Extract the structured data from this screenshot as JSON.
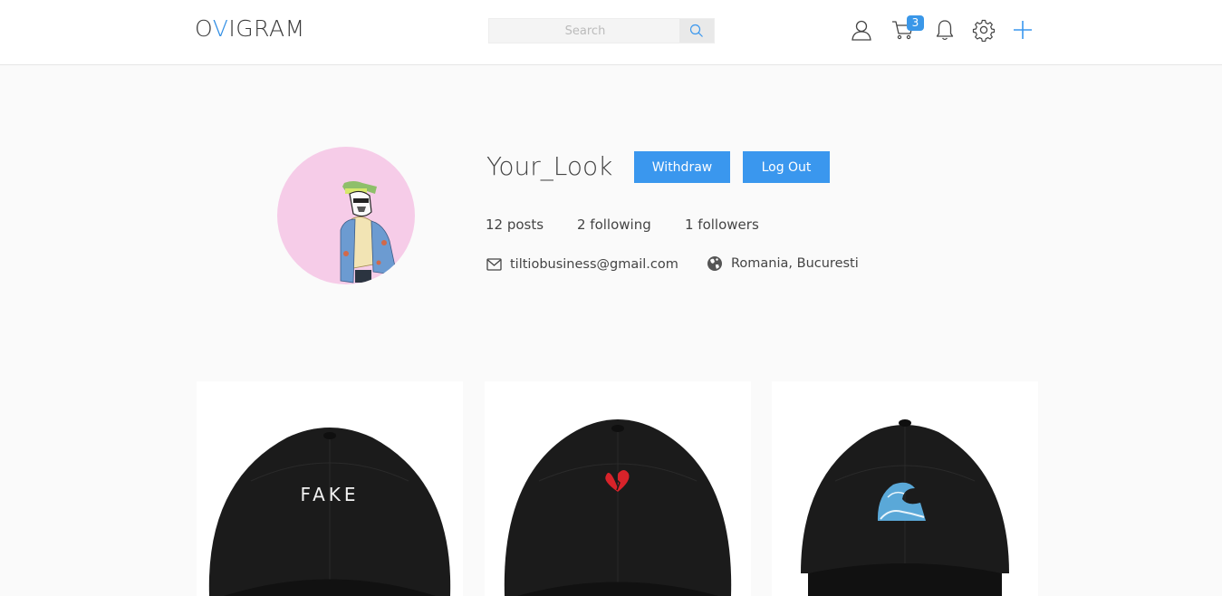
{
  "header": {
    "logo_prefix": "O",
    "logo_accent": "V",
    "logo_suffix": "IGRAM",
    "search_placeholder": "Search",
    "cart_count": "3",
    "icons": [
      "user-icon",
      "cart-icon",
      "bell-icon",
      "gear-icon",
      "plus-icon"
    ]
  },
  "profile": {
    "username": "Your_Look",
    "withdraw_label": "Withdraw",
    "logout_label": "Log Out",
    "posts": "12 posts",
    "following": "2 following",
    "followers": "1 followers",
    "email": "tiltiobusiness@gmail.com",
    "location": "Romania, Bucuresti"
  },
  "posts": [
    {
      "cap_text": "FAKE"
    },
    {
      "cap_text": ""
    },
    {
      "cap_text": ""
    }
  ],
  "colors": {
    "accent": "#3a97ee",
    "avatar_bg": "#f6cce8"
  }
}
